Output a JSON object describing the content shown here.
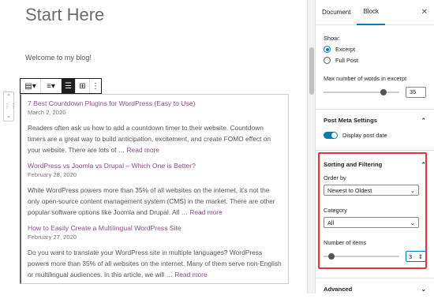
{
  "editor": {
    "title": "Start Here",
    "welcome": "Welcome to my blog!",
    "posts": [
      {
        "title": "7 Best Countdown Plugins for WordPress (Easy to Use)",
        "date": "March 2, 2020",
        "excerpt": "Readers often ask us how to add a countdown timer to their website. Countdown timers are a great way to build anticipation, excitement, and create FOMO effect on your website. There are lots of …",
        "more": "Read more"
      },
      {
        "title": "WordPress vs Joomla vs Drupal – Which One is Better?",
        "date": "February 28, 2020",
        "excerpt": "While WordPress powers more than 35% of all websites on the internet, it’s not the only open-source content management system (CMS) in the market. There are other popular software options like Joomla and Drupal. All …",
        "more": "Read more"
      },
      {
        "title": "How to Easily Create a Multilingual WordPress Site",
        "date": "February 27, 2020",
        "excerpt": "Do you want to translate your WordPress site in multiple languages? WordPress powers more than 35% of all websites on the internet. Many of them serve non-English or multilingual audiences. In this article, we will …",
        "more": "Read more"
      }
    ]
  },
  "sidebar": {
    "tabs": [
      "Document",
      "Block"
    ],
    "show_label": "Show:",
    "show_options": [
      "Excerpt",
      "Full Post"
    ],
    "max_words_label": "Max number of words in excerpt",
    "max_words_value": "35",
    "post_meta_title": "Post Meta Settings",
    "display_post_date": "Display post date",
    "sorting_title": "Sorting and Filtering",
    "order_by_label": "Order by",
    "order_by_value": "Newest to Oldest",
    "category_label": "Category",
    "category_value": "All",
    "number_label": "Number of items",
    "number_value": "3",
    "advanced_title": "Advanced"
  }
}
